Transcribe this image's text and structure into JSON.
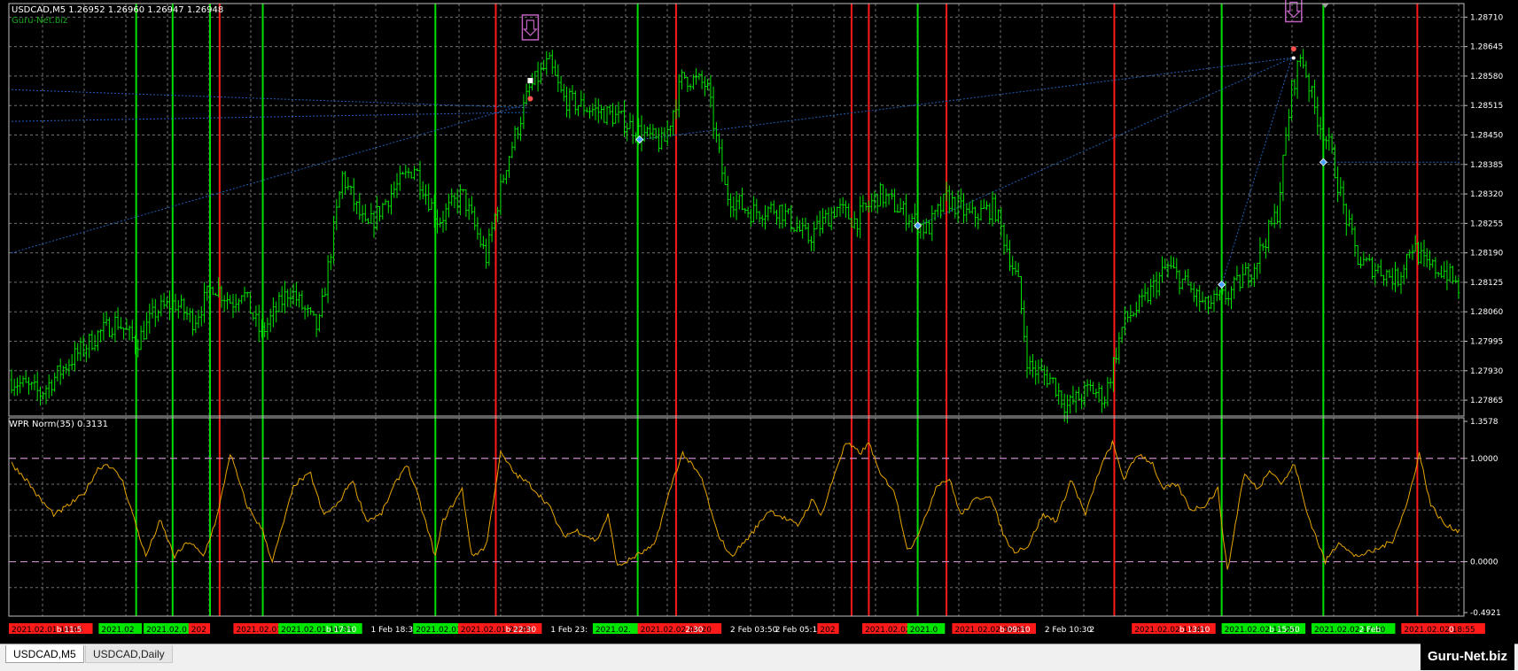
{
  "header": {
    "symbol_info": "USDCAD,M5  1.26952 1.26960 1.26947 1.26948",
    "site": "Guru-Net.biz"
  },
  "indicator": {
    "title": "WPR Norm(35) 0.3131"
  },
  "tabs": [
    {
      "label": "USDCAD,M5",
      "active": true
    },
    {
      "label": "USDCAD,Daily",
      "active": false
    }
  ],
  "watermark": "Guru-Net.biz",
  "colors": {
    "background": "#000000",
    "grid": "#6f6f6f",
    "candle": "#00e600",
    "buy_line": "#00e000",
    "sell_line": "#ff1a1a",
    "wpr_line": "#e6a400",
    "level_line": "#c88cc8",
    "trend_line": "#1f5fb8"
  },
  "chart_data": [
    {
      "type": "line",
      "name": "price-chart",
      "ylim": [
        1.2783,
        1.2874
      ],
      "y_ticks": [
        "1.28710",
        "1.28645",
        "1.28580",
        "1.28515",
        "1.28450",
        "1.28385",
        "1.28320",
        "1.28255",
        "1.28190",
        "1.28125",
        "1.28060",
        "1.27995",
        "1.27930",
        "1.27865"
      ],
      "x_labels": [
        "2021.02.01 10:05",
        "b 11:5",
        "2021.02",
        "2021.02.0",
        "202",
        "2021.02.01",
        "2021.02.01 16:35",
        "b 17:10",
        "1 Feb 18:30",
        "2021.02.01 20:",
        "2021.02.01 22:05",
        "b 22:30",
        "1 Feb 23:",
        "2021.02.",
        "2021.02.02 02:20",
        "2:30",
        "2 Feb 03:50",
        "2 Feb 05:10",
        "202",
        "2021.02.02",
        "2021.0",
        "2021.02.02 08:05",
        "b 09:10",
        "2 Feb 10:30",
        "2",
        "2021.02.02 12:45",
        "b 13:10",
        "2021.02.02 15:20",
        "b 15:50",
        "2021.02.02 17:40",
        "2 Feb",
        "2021.02.02 18:55",
        "0"
      ],
      "close_anchors": [
        [
          0,
          1.2791
        ],
        [
          30,
          1.2788
        ],
        [
          60,
          1.2795
        ],
        [
          90,
          1.2801
        ],
        [
          110,
          1.2804
        ],
        [
          130,
          1.2799
        ],
        [
          150,
          1.2806
        ],
        [
          170,
          1.2808
        ],
        [
          190,
          1.2804
        ],
        [
          210,
          1.2812
        ],
        [
          230,
          1.2808
        ],
        [
          240,
          1.2811
        ],
        [
          260,
          1.2801
        ],
        [
          290,
          1.2811
        ],
        [
          320,
          1.2802
        ],
        [
          345,
          1.2836
        ],
        [
          370,
          1.2824
        ],
        [
          395,
          1.2832
        ],
        [
          420,
          1.2838
        ],
        [
          445,
          1.2826
        ],
        [
          470,
          1.2832
        ],
        [
          495,
          1.2818
        ],
        [
          515,
          1.2838
        ],
        [
          540,
          1.2855
        ],
        [
          560,
          1.2861
        ],
        [
          575,
          1.2853
        ],
        [
          600,
          1.2851
        ],
        [
          630,
          1.2849
        ],
        [
          660,
          1.2845
        ],
        [
          680,
          1.2843
        ],
        [
          700,
          1.2858
        ],
        [
          725,
          1.2856
        ],
        [
          745,
          1.2832
        ],
        [
          770,
          1.2828
        ],
        [
          800,
          1.2829
        ],
        [
          830,
          1.2822
        ],
        [
          860,
          1.2829
        ],
        [
          880,
          1.2826
        ],
        [
          905,
          1.2832
        ],
        [
          930,
          1.2828
        ],
        [
          955,
          1.2824
        ],
        [
          975,
          1.2831
        ],
        [
          1000,
          1.2827
        ],
        [
          1025,
          1.2829
        ],
        [
          1050,
          1.2812
        ],
        [
          1060,
          1.2794
        ],
        [
          1085,
          1.2791
        ],
        [
          1100,
          1.2785
        ],
        [
          1125,
          1.2789
        ],
        [
          1140,
          1.2787
        ],
        [
          1160,
          1.2804
        ],
        [
          1180,
          1.2808
        ],
        [
          1205,
          1.2816
        ],
        [
          1225,
          1.2812
        ],
        [
          1245,
          1.2807
        ],
        [
          1270,
          1.281
        ],
        [
          1295,
          1.2816
        ],
        [
          1320,
          1.2828
        ],
        [
          1335,
          1.2855
        ],
        [
          1345,
          1.2863
        ],
        [
          1360,
          1.285
        ],
        [
          1375,
          1.2842
        ],
        [
          1390,
          1.2828
        ],
        [
          1405,
          1.2817
        ],
        [
          1430,
          1.2815
        ],
        [
          1445,
          1.2813
        ],
        [
          1460,
          1.2821
        ],
        [
          1475,
          1.2816
        ],
        [
          1495,
          1.2815
        ],
        [
          1510,
          1.2811
        ]
      ]
    },
    {
      "type": "line",
      "name": "wpr-norm-35",
      "ylim": [
        -0.4921,
        1.3578
      ],
      "y_ticks": [
        "1.3578",
        "1.0000",
        "0.0000",
        "-0.4921"
      ],
      "levels": [
        1.0,
        0.0
      ],
      "anchors": [
        [
          0,
          0.95
        ],
        [
          15,
          0.8
        ],
        [
          30,
          0.6
        ],
        [
          45,
          0.45
        ],
        [
          60,
          0.55
        ],
        [
          75,
          0.65
        ],
        [
          90,
          0.9
        ],
        [
          100,
          0.95
        ],
        [
          115,
          0.8
        ],
        [
          130,
          0.35
        ],
        [
          140,
          0.05
        ],
        [
          155,
          0.4
        ],
        [
          170,
          0.05
        ],
        [
          185,
          0.2
        ],
        [
          200,
          0.05
        ],
        [
          215,
          0.45
        ],
        [
          228,
          1.05
        ],
        [
          245,
          0.55
        ],
        [
          262,
          0.3
        ],
        [
          272,
          0.0
        ],
        [
          295,
          0.75
        ],
        [
          312,
          0.85
        ],
        [
          325,
          0.45
        ],
        [
          340,
          0.55
        ],
        [
          355,
          0.8
        ],
        [
          370,
          0.4
        ],
        [
          385,
          0.45
        ],
        [
          400,
          0.75
        ],
        [
          412,
          0.95
        ],
        [
          425,
          0.6
        ],
        [
          442,
          0.05
        ],
        [
          450,
          0.4
        ],
        [
          470,
          0.7
        ],
        [
          480,
          0.05
        ],
        [
          495,
          0.15
        ],
        [
          510,
          1.05
        ],
        [
          525,
          0.85
        ],
        [
          540,
          0.75
        ],
        [
          560,
          0.55
        ],
        [
          575,
          0.25
        ],
        [
          590,
          0.3
        ],
        [
          610,
          0.2
        ],
        [
          622,
          0.45
        ],
        [
          632,
          -0.05
        ],
        [
          650,
          0.05
        ],
        [
          670,
          0.15
        ],
        [
          690,
          0.8
        ],
        [
          700,
          1.05
        ],
        [
          720,
          0.8
        ],
        [
          735,
          0.3
        ],
        [
          750,
          0.05
        ],
        [
          770,
          0.25
        ],
        [
          790,
          0.5
        ],
        [
          800,
          0.45
        ],
        [
          820,
          0.35
        ],
        [
          835,
          0.6
        ],
        [
          845,
          0.45
        ],
        [
          860,
          0.9
        ],
        [
          870,
          1.15
        ],
        [
          885,
          1.05
        ],
        [
          895,
          1.15
        ],
        [
          905,
          0.85
        ],
        [
          920,
          0.7
        ],
        [
          935,
          0.1
        ],
        [
          950,
          0.35
        ],
        [
          965,
          0.75
        ],
        [
          978,
          0.8
        ],
        [
          990,
          0.45
        ],
        [
          1005,
          0.6
        ],
        [
          1020,
          0.65
        ],
        [
          1035,
          0.25
        ],
        [
          1045,
          0.1
        ],
        [
          1060,
          0.15
        ],
        [
          1075,
          0.45
        ],
        [
          1090,
          0.4
        ],
        [
          1105,
          0.8
        ],
        [
          1120,
          0.45
        ],
        [
          1135,
          0.9
        ],
        [
          1148,
          1.15
        ],
        [
          1160,
          0.8
        ],
        [
          1175,
          1.05
        ],
        [
          1190,
          0.95
        ],
        [
          1200,
          0.7
        ],
        [
          1215,
          0.75
        ],
        [
          1230,
          0.5
        ],
        [
          1245,
          0.55
        ],
        [
          1258,
          0.7
        ],
        [
          1268,
          -0.1
        ],
        [
          1285,
          0.85
        ],
        [
          1300,
          0.7
        ],
        [
          1312,
          0.9
        ],
        [
          1325,
          0.75
        ],
        [
          1338,
          0.95
        ],
        [
          1350,
          0.5
        ],
        [
          1362,
          0.2
        ],
        [
          1370,
          0.0
        ],
        [
          1385,
          0.2
        ],
        [
          1400,
          0.05
        ],
        [
          1420,
          0.1
        ],
        [
          1440,
          0.2
        ],
        [
          1455,
          0.55
        ],
        [
          1468,
          1.05
        ],
        [
          1480,
          0.55
        ],
        [
          1495,
          0.35
        ],
        [
          1510,
          0.3
        ]
      ]
    }
  ]
}
